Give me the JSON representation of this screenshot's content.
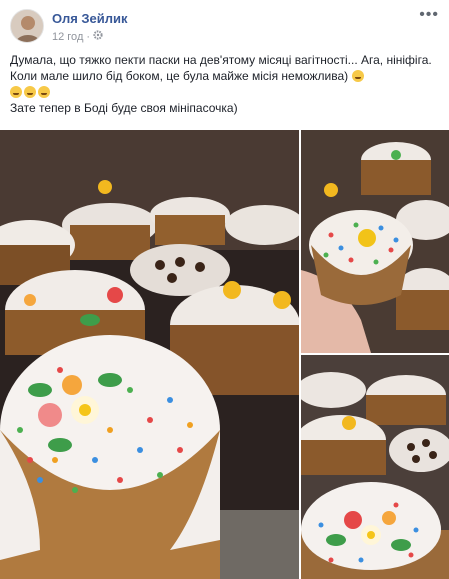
{
  "post": {
    "author": "Оля Зейлик",
    "time": "12 год",
    "privacy_icon": "gear-icon",
    "menu_icon": "more-horizontal-icon",
    "text_line1": "Думала, що тяжко пекти паски на дев'ятому місяці вагітності... Ага, нініфіга. Коли мале шило бід боком, це була майже місія неможлива)",
    "text_line3": "Зате тепер в Боді буде своя мініпасочка)"
  },
  "photos": [
    {
      "name": "photo-main",
      "alt": "easter cakes tray"
    },
    {
      "name": "photo-top-right",
      "alt": "hand holding easter cake"
    },
    {
      "name": "photo-bottom-right",
      "alt": "easter cakes with decorations"
    }
  ]
}
